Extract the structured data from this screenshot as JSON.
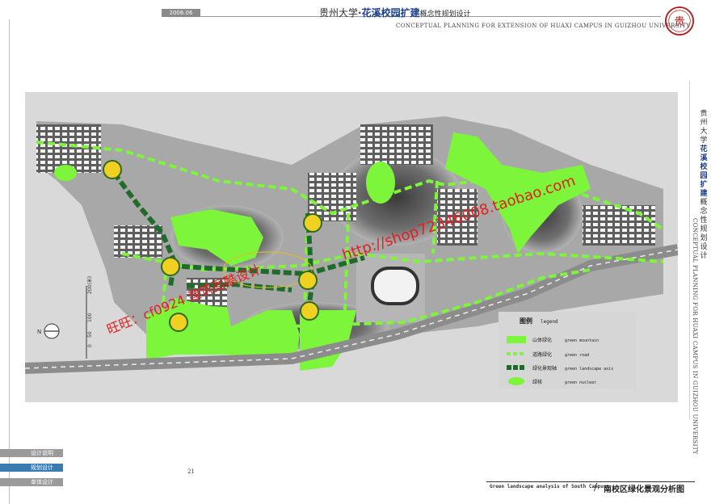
{
  "header": {
    "date": "2006.06",
    "title_main": "贵州大学",
    "title_highlight": "·花溪校园扩建",
    "title_suffix": "概念性规划设计",
    "title_en": "CONCEPTUAL PLANNING FOR EXTENSION OF HUAXI CAMPUS IN GUIZHOU UNIVERSITY"
  },
  "seal": {
    "glyph": "贵"
  },
  "side_title": {
    "cn_main": "贵州大学",
    "cn_highlight": "花溪校园扩建",
    "cn_suffix": "概念性规划设计",
    "en": "CONCEPTUAL PLANNING FOR HUAXI CAMPUS IN GUIZHOU UNIVERSITY"
  },
  "map": {
    "scale_label": "200(米)",
    "scale_ticks": [
      "0",
      "50",
      "100"
    ],
    "north_label": "N",
    "legend_title": "图例",
    "legend_title_en": "legend",
    "legend": [
      {
        "cn": "山体绿化",
        "en": "green mountain",
        "color": "#7cf53a"
      },
      {
        "cn": "道路绿化",
        "en": "green road",
        "color": "#7cf53a"
      },
      {
        "cn": "绿化景观轴",
        "en": "green landscape axis",
        "color": "#1f6b2a"
      },
      {
        "cn": "绿核",
        "en": "green nuclear",
        "color": "#7cf53a"
      }
    ],
    "watermark_url": "http://shop72346008.taobao.com",
    "watermark_contact": "旺旺：cf0924 建筑图酷设计"
  },
  "nav": {
    "items": [
      {
        "label": "设计说明",
        "active": false
      },
      {
        "label": "规划设计",
        "active": true
      },
      {
        "label": "单体设计",
        "active": false
      }
    ]
  },
  "page_number": "21",
  "footer": {
    "en": "Green landscape analysis of South Campus",
    "cn": "南校区绿化景观分析图"
  },
  "colors": {
    "accent_blue": "#1d3f8a",
    "green_mountain": "#7cf53a",
    "green_axis": "#1f6b2a",
    "red_watermark": "#e02020",
    "nav_active": "#3b7bb0",
    "nav_inactive": "#9a9a9a"
  }
}
